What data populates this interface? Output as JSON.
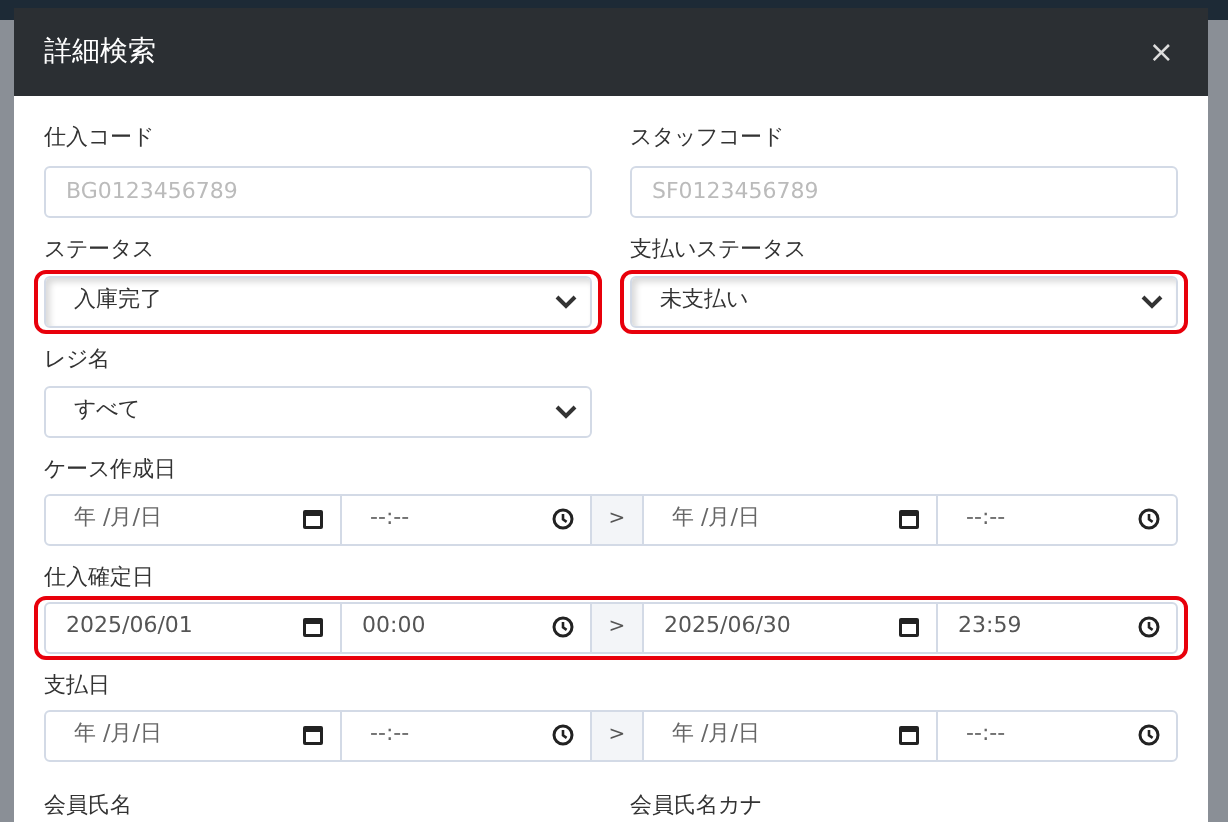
{
  "dialog": {
    "title": "詳細検索",
    "close": "×"
  },
  "field_rows": [
    [
      {
        "kind": "text",
        "label": "仕入コード",
        "placeholder": "BG0123456789",
        "highlighted": false
      },
      {
        "kind": "text",
        "label": "スタッフコード",
        "placeholder": "SF0123456789",
        "highlighted": false
      }
    ],
    [
      {
        "kind": "select",
        "label": "ステータス",
        "value": "入庫完了",
        "highlighted": true
      },
      {
        "kind": "select",
        "label": "支払いステータス",
        "value": "未支払い",
        "highlighted": true
      }
    ],
    [
      {
        "kind": "select",
        "label": "レジ名",
        "value": "すべて",
        "highlighted": false
      }
    ]
  ],
  "date_ranges": [
    {
      "label": "ケース作成日",
      "from_date": {
        "placeholder": "年 /月/日"
      },
      "from_time": {
        "placeholder": "--:--"
      },
      "separator": ">",
      "to_date": {
        "placeholder": "年 /月/日"
      },
      "to_time": {
        "placeholder": "--:--"
      },
      "highlighted": false
    },
    {
      "label": "仕入確定日",
      "from_date": {
        "value": "2025/06/01"
      },
      "from_time": {
        "value": "00:00"
      },
      "separator": ">",
      "to_date": {
        "value": "2025/06/30"
      },
      "to_time": {
        "value": "23:59"
      },
      "highlighted": true
    },
    {
      "label": "支払日",
      "from_date": {
        "placeholder": "年 /月/日"
      },
      "from_time": {
        "placeholder": "--:--"
      },
      "separator": ">",
      "to_date": {
        "placeholder": "年 /月/日"
      },
      "to_time": {
        "placeholder": "--:--"
      },
      "highlighted": false
    }
  ],
  "bottom_labels": [
    "会員氏名",
    "会員氏名カナ"
  ]
}
